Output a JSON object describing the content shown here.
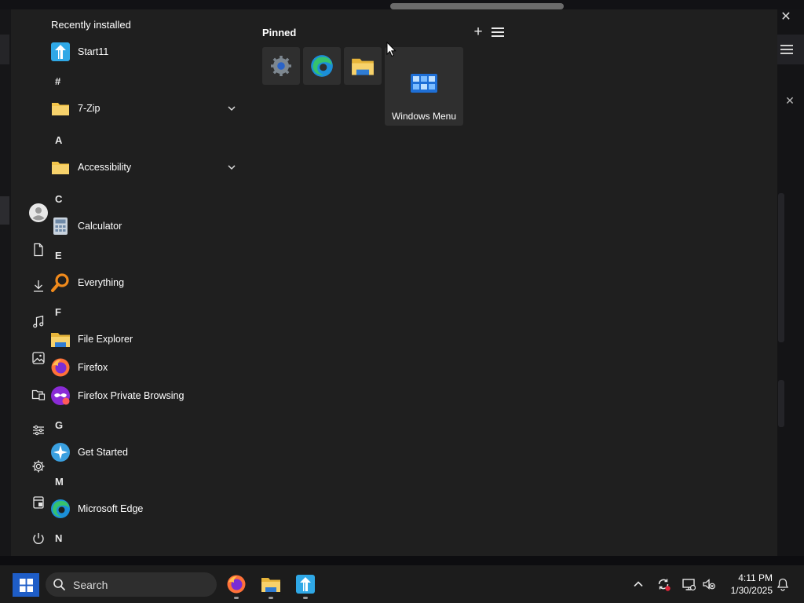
{
  "start_menu": {
    "list_header": "Recently installed",
    "recent_app": {
      "label": "Start11",
      "icon": "start11-icon"
    },
    "letters": [
      "#",
      "A",
      "C",
      "E",
      "F",
      "G",
      "M",
      "N"
    ],
    "apps": {
      "seven_zip": "7-Zip",
      "accessibility": "Accessibility",
      "calculator": "Calculator",
      "everything": "Everything",
      "file_explorer": "File Explorer",
      "firefox": "Firefox",
      "firefox_private": "Firefox Private Browsing",
      "get_started": "Get Started",
      "edge": "Microsoft Edge"
    },
    "rail_icons": [
      "user-avatar-icon",
      "documents-icon",
      "downloads-icon",
      "music-icon",
      "pictures-icon",
      "network-folder-icon",
      "control-panel-icon",
      "settings-icon",
      "file-explorer-icon",
      "power-icon"
    ],
    "pinned": {
      "title": "Pinned",
      "add_glyph": "+",
      "tiles": [
        "settings-icon",
        "edge-icon",
        "file-explorer-icon"
      ],
      "large_tile_label": "Windows Menu"
    },
    "close_glyph": "✕"
  },
  "taskbar": {
    "search_label": "Search",
    "pinned_apps": [
      "firefox-icon",
      "file-explorer-icon",
      "start11-icon"
    ],
    "clock": {
      "time": "4:11 PM",
      "date": "1/30/2025"
    },
    "tray_icons": [
      "show-hidden-icon",
      "sync-icon",
      "network-icon",
      "volume-muted-icon",
      "notifications-icon"
    ]
  },
  "colors": {
    "menu_bg": "#1f1f1f",
    "tile_bg": "#2f2f2f",
    "taskbar_bg": "#1c1c1c",
    "accent": "#1e5dc7"
  }
}
